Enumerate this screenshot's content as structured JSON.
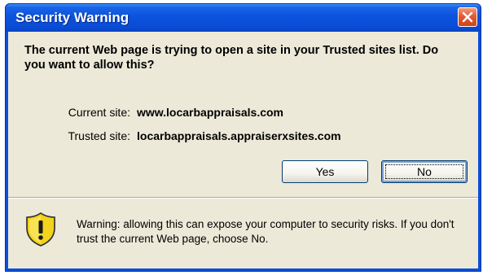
{
  "window": {
    "title": "Security Warning"
  },
  "message": "The current Web page is trying to open a site in your Trusted sites list. Do you want to allow this?",
  "sites": {
    "current_label": "Current site:",
    "current_value": "www.locarbappraisals.com",
    "trusted_label": "Trusted site:",
    "trusted_value": "locarbappraisals.appraiserxsites.com"
  },
  "buttons": {
    "yes": "Yes",
    "no": "No"
  },
  "warning": {
    "text": "Warning: allowing this can expose your computer to security risks. If you don't trust the current Web page, choose No."
  },
  "colors": {
    "titlebar": "#0a4fd8",
    "client": "#ece9d8",
    "close": "#e25a33",
    "shield": "#f2d21c"
  },
  "icons": {
    "close": "close-icon",
    "warning": "warning-shield-icon"
  }
}
